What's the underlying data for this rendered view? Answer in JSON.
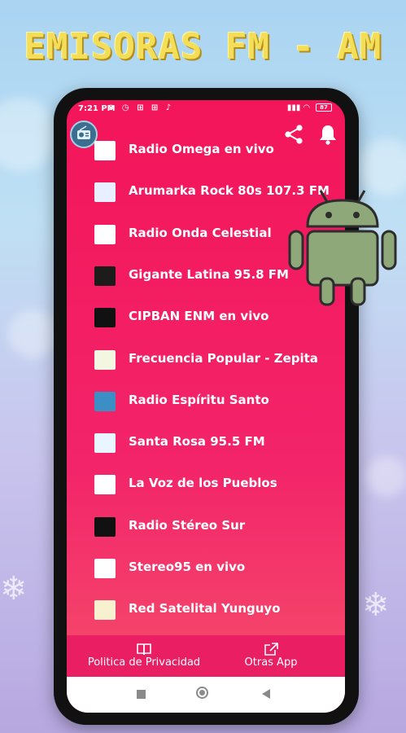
{
  "banner": {
    "title": "EMISORAS FM - AM"
  },
  "status_bar": {
    "time": "7:21 PM",
    "battery": "87"
  },
  "app_bar": {
    "share_icon": "share-icon",
    "bell_icon": "bell-icon"
  },
  "stations": [
    {
      "name": "Radio Omega en vivo",
      "color": "#ffffff"
    },
    {
      "name": "Arumarka Rock 80s 107.3 FM",
      "color": "#e8f0ff"
    },
    {
      "name": "Radio Onda Celestial",
      "color": "#ffffff"
    },
    {
      "name": "Gigante Latina 95.8 FM",
      "color": "#1c1c1c"
    },
    {
      "name": "CIPBAN ENM en vivo",
      "color": "#111111"
    },
    {
      "name": "Frecuencia Popular - Zepita",
      "color": "#f3f7e2"
    },
    {
      "name": "Radio Espíritu Santo",
      "color": "#3c8fc4"
    },
    {
      "name": "Santa Rosa 95.5 FM",
      "color": "#eaf6ff"
    },
    {
      "name": "La Voz de los Pueblos",
      "color": "#ffffff"
    },
    {
      "name": "Radio Stéreo Sur",
      "color": "#111111"
    },
    {
      "name": "Stereo95 en vivo",
      "color": "#ffffff"
    },
    {
      "name": "Red Satelital Yunguyo",
      "color": "#f7f1cf"
    }
  ],
  "bottom_nav": {
    "privacy_label": "Politica de Privacidad",
    "other_apps_label": "Otras App"
  },
  "colors": {
    "accent": "#e91e63",
    "banner_text": "#f4de58"
  }
}
